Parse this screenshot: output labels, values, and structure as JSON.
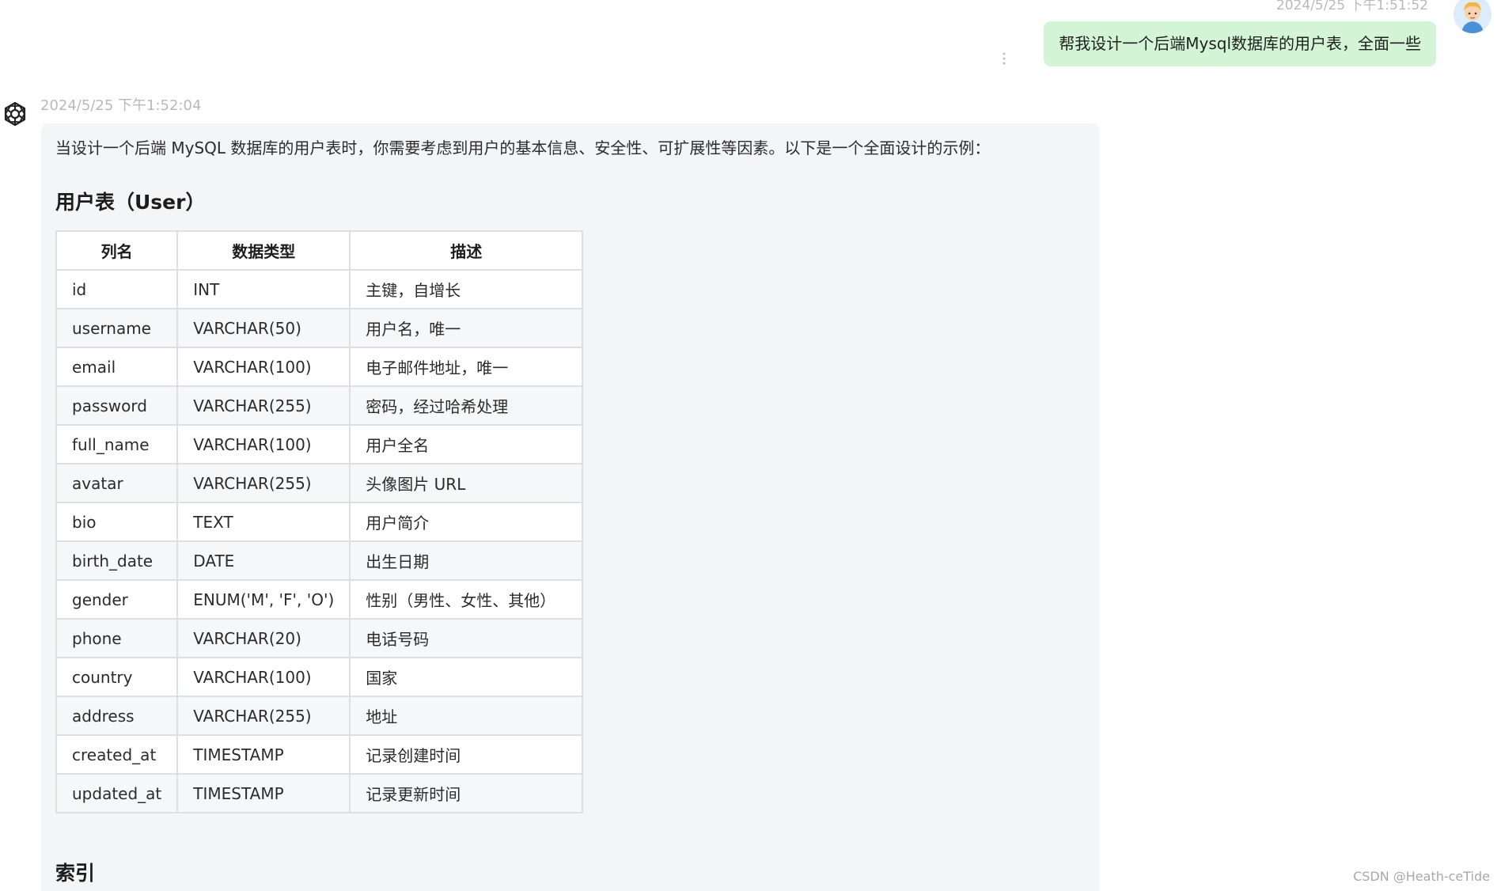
{
  "user_message": {
    "time": "2024/5/25 下午1:51:52",
    "text": "帮我设计一个后端Mysql数据库的用户表，全面一些"
  },
  "assistant_message": {
    "time": "2024/5/25 下午1:52:04",
    "intro": "当设计一个后端 MySQL 数据库的用户表时，你需要考虑到用户的基本信息、安全性、可扩展性等因素。以下是一个全面设计的示例：",
    "table_heading": "用户表（User）",
    "table": {
      "headers": [
        "列名",
        "数据类型",
        "描述"
      ],
      "rows": [
        [
          "id",
          "INT",
          "主键，自增长"
        ],
        [
          "username",
          "VARCHAR(50)",
          "用户名，唯一"
        ],
        [
          "email",
          "VARCHAR(100)",
          "电子邮件地址，唯一"
        ],
        [
          "password",
          "VARCHAR(255)",
          "密码，经过哈希处理"
        ],
        [
          "full_name",
          "VARCHAR(100)",
          "用户全名"
        ],
        [
          "avatar",
          "VARCHAR(255)",
          "头像图片 URL"
        ],
        [
          "bio",
          "TEXT",
          "用户简介"
        ],
        [
          "birth_date",
          "DATE",
          "出生日期"
        ],
        [
          "gender",
          "ENUM('M', 'F', 'O')",
          "性别（男性、女性、其他）"
        ],
        [
          "phone",
          "VARCHAR(20)",
          "电话号码"
        ],
        [
          "country",
          "VARCHAR(100)",
          "国家"
        ],
        [
          "address",
          "VARCHAR(255)",
          "地址"
        ],
        [
          "created_at",
          "TIMESTAMP",
          "记录创建时间"
        ],
        [
          "updated_at",
          "TIMESTAMP",
          "记录更新时间"
        ]
      ]
    },
    "next_heading": "索引"
  },
  "watermark": "CSDN @Heath-ceTide",
  "icons": {
    "user_avatar": "user-avatar-icon",
    "assistant_avatar": "openai-logo-icon",
    "more": "vertical-dots-icon"
  },
  "colors": {
    "user_bubble": "#d3f5d5",
    "assistant_bubble": "#f4f5f7",
    "timestamp": "#b9b9b9"
  }
}
